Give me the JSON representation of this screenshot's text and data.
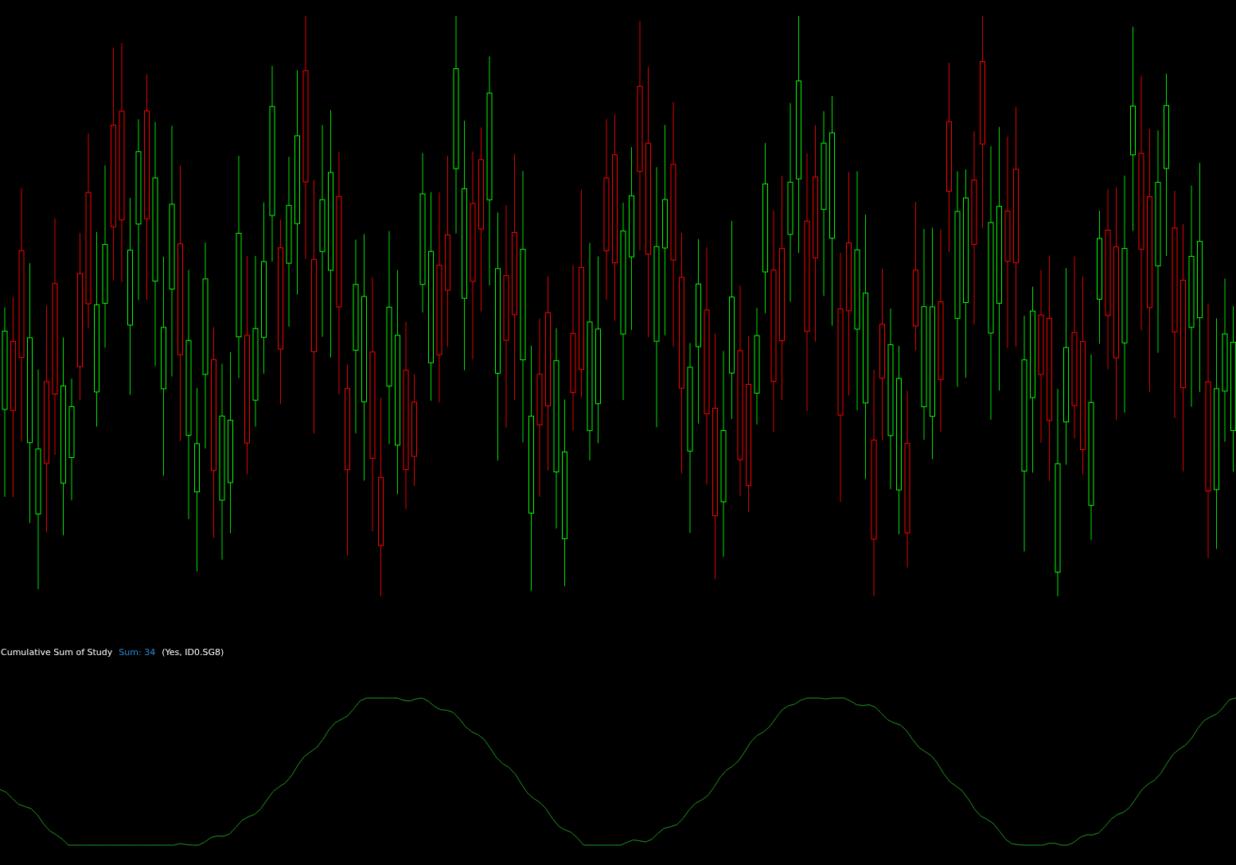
{
  "study": {
    "title": "Cumulative Sum of Study",
    "sum": "Sum: 34",
    "params": "(Yes, ID0.SG8)"
  }
}
